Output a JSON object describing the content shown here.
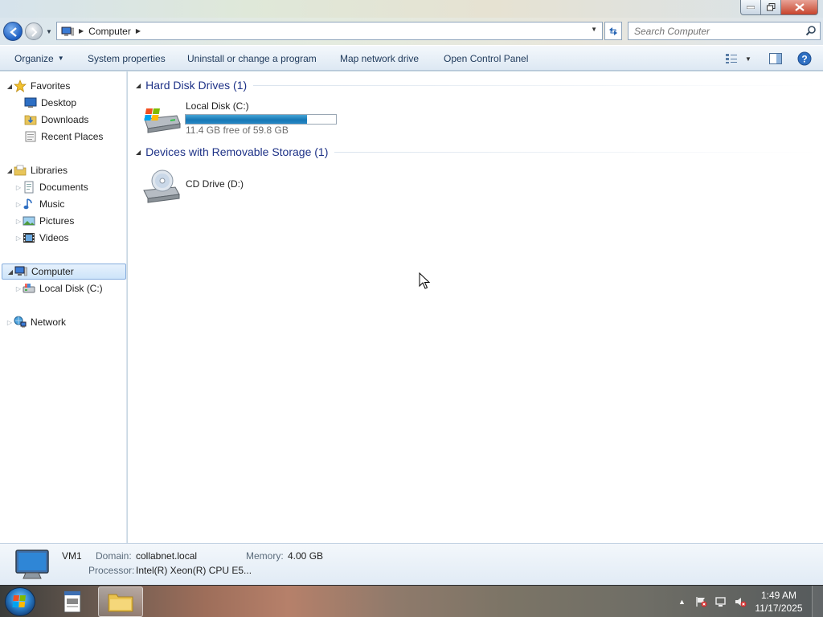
{
  "window": {
    "address": {
      "segments": [
        "Computer"
      ]
    },
    "search": {
      "placeholder": "Search Computer"
    }
  },
  "toolbar": {
    "organize": "Organize",
    "system_properties": "System properties",
    "uninstall": "Uninstall or change a program",
    "map_network_drive": "Map network drive",
    "open_control_panel": "Open Control Panel"
  },
  "navpane": {
    "favorites": {
      "label": "Favorites",
      "items": [
        "Desktop",
        "Downloads",
        "Recent Places"
      ]
    },
    "libraries": {
      "label": "Libraries",
      "items": [
        "Documents",
        "Music",
        "Pictures",
        "Videos"
      ]
    },
    "computer": {
      "label": "Computer",
      "items": [
        "Local Disk (C:)"
      ]
    },
    "network": {
      "label": "Network"
    }
  },
  "content": {
    "hard_disk_group": "Hard Disk Drives (1)",
    "local_disk": {
      "name": "Local Disk (C:)",
      "free_text": "11.4 GB free of 59.8 GB",
      "used_fraction": 0.81
    },
    "removable_group": "Devices with Removable Storage (1)",
    "cd_drive": {
      "name": "CD Drive (D:)"
    }
  },
  "details": {
    "name": "VM1",
    "domain_label": "Domain:",
    "domain_value": "collabnet.local",
    "memory_label": "Memory:",
    "memory_value": "4.00 GB",
    "processor_label": "Processor:",
    "processor_value": "Intel(R) Xeon(R) CPU E5..."
  },
  "taskbar": {
    "time": "1:49 AM",
    "date": "11/17/2025"
  },
  "colors": {
    "accent": "#1e3287",
    "drive_bar": "#2587c4",
    "toolbar_text": "#1e395b"
  }
}
